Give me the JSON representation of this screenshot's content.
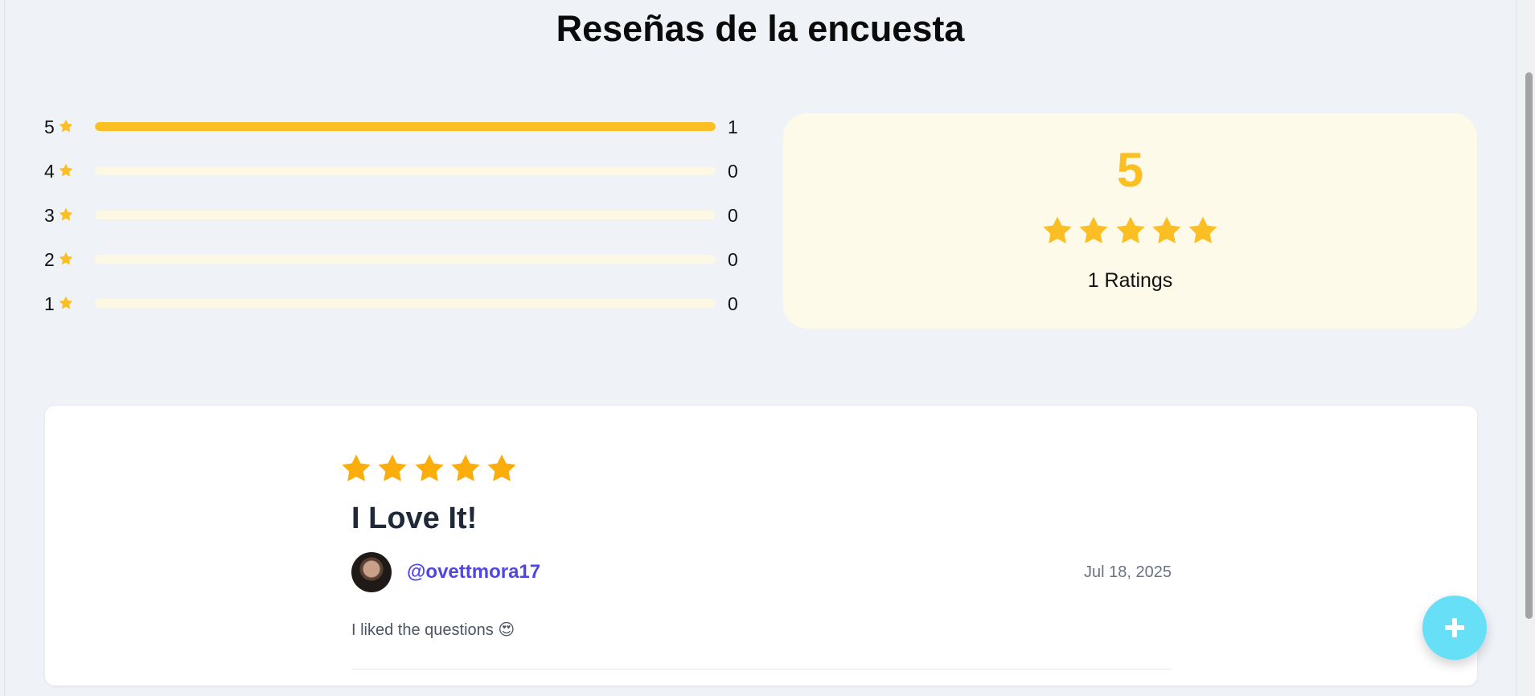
{
  "page": {
    "title": "Reseñas de la encuesta"
  },
  "distribution": [
    {
      "stars": "5",
      "count": "1",
      "fraction": 1.0
    },
    {
      "stars": "4",
      "count": "0",
      "fraction": 0
    },
    {
      "stars": "3",
      "count": "0",
      "fraction": 0
    },
    {
      "stars": "2",
      "count": "0",
      "fraction": 0
    },
    {
      "stars": "1",
      "count": "0",
      "fraction": 0
    }
  ],
  "summary": {
    "average": "5",
    "rating": 5,
    "ratings_label": "1 Ratings"
  },
  "review": {
    "rating": 5,
    "title": "I Love It!",
    "author": "@ovettmora17",
    "date": "Jul 18, 2025",
    "text": "I liked the questions 😍"
  },
  "fab": {
    "icon": "plus-icon"
  },
  "colors": {
    "background": "#eff3f8",
    "star": "#fbbf24",
    "bar_track": "#fdf8e3",
    "summary_card": "#fefae9",
    "author_link": "#4f46e5",
    "fab": "#67e0f7"
  }
}
